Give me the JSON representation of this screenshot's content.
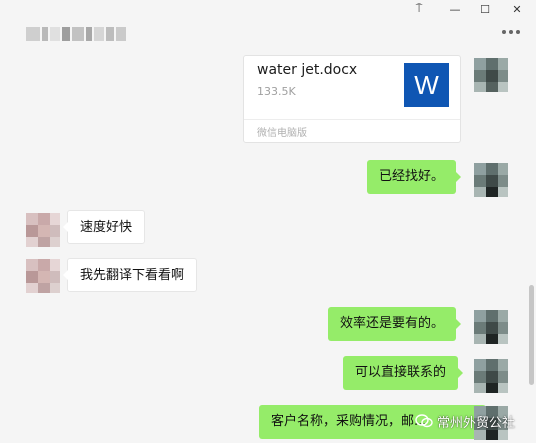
{
  "window": {
    "controls": {
      "pin": "⍑",
      "minimize": "—",
      "maximize": "☐",
      "close": "✕"
    }
  },
  "header": {
    "contact_name": "",
    "more_icon": "more-dots-icon"
  },
  "messages": [
    {
      "type": "file",
      "side": "right",
      "file_name": "water jet.docx",
      "file_size": "133.5K",
      "file_icon_letter": "W",
      "source": "微信电脑版"
    },
    {
      "type": "text",
      "side": "right",
      "text": "已经找好。"
    },
    {
      "type": "text",
      "side": "left",
      "text": "速度好快"
    },
    {
      "type": "text",
      "side": "left",
      "text": "我先翻译下看看啊"
    },
    {
      "type": "text",
      "side": "right",
      "text": "效率还是要有的。"
    },
    {
      "type": "text",
      "side": "right",
      "text": "可以直接联系的"
    },
    {
      "type": "text",
      "side": "right",
      "text": "客户名称，采购情况，邮..."
    }
  ],
  "watermark": {
    "text": "常州外贸公社"
  },
  "colors": {
    "sent_bubble": "#95ec69",
    "received_bubble": "#ffffff",
    "word_icon": "#0f56b3",
    "background": "#f5f5f5"
  }
}
